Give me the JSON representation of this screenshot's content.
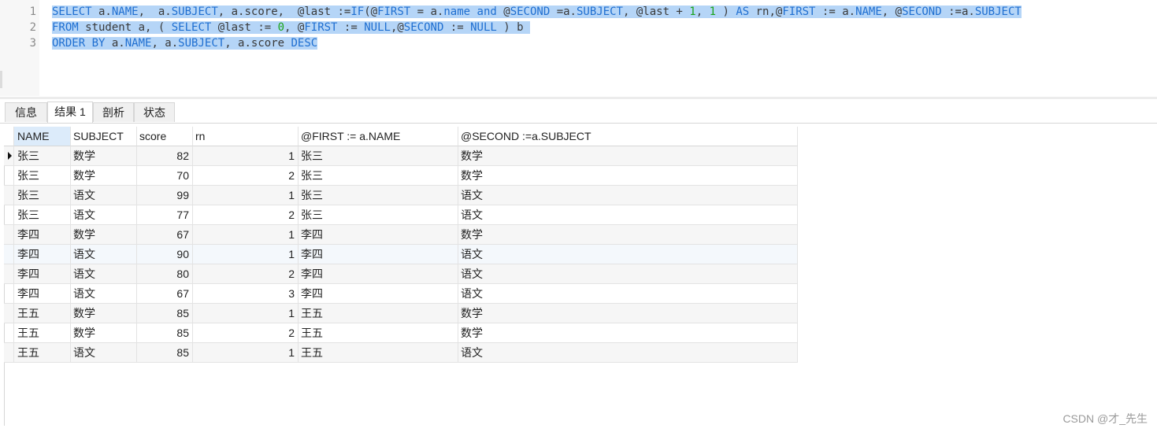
{
  "editor": {
    "line_numbers": [
      "1",
      "2",
      "3"
    ],
    "line1": [
      {
        "t": "SELECT",
        "k": "kw"
      },
      {
        "t": " a.",
        "k": ""
      },
      {
        "t": "NAME",
        "k": "kw"
      },
      {
        "t": ",  a.",
        "k": ""
      },
      {
        "t": "SUBJECT",
        "k": "kw"
      },
      {
        "t": ", a.score,  @last :=",
        "k": ""
      },
      {
        "t": "IF",
        "k": "kw"
      },
      {
        "t": "(@",
        "k": ""
      },
      {
        "t": "FIRST",
        "k": "kw"
      },
      {
        "t": " = a.",
        "k": ""
      },
      {
        "t": "name",
        "k": "kw"
      },
      {
        "t": " ",
        "k": ""
      },
      {
        "t": "and",
        "k": "kw"
      },
      {
        "t": " @",
        "k": ""
      },
      {
        "t": "SECOND",
        "k": "kw"
      },
      {
        "t": " =a.",
        "k": ""
      },
      {
        "t": "SUBJECT",
        "k": "kw"
      },
      {
        "t": ", @last + ",
        "k": ""
      },
      {
        "t": "1",
        "k": "num"
      },
      {
        "t": ", ",
        "k": ""
      },
      {
        "t": "1",
        "k": "num"
      },
      {
        "t": " ) ",
        "k": ""
      },
      {
        "t": "AS",
        "k": "kw"
      },
      {
        "t": " rn,@",
        "k": ""
      },
      {
        "t": "FIRST",
        "k": "kw"
      },
      {
        "t": " := a.",
        "k": ""
      },
      {
        "t": "NAME",
        "k": "kw"
      },
      {
        "t": ", @",
        "k": ""
      },
      {
        "t": "SECOND",
        "k": "kw"
      },
      {
        "t": " :=a.",
        "k": ""
      },
      {
        "t": "SUBJECT",
        "k": "kw"
      }
    ],
    "line2": [
      {
        "t": "FROM",
        "k": "kw"
      },
      {
        "t": " student a, ( ",
        "k": ""
      },
      {
        "t": "SELECT",
        "k": "kw"
      },
      {
        "t": " @last := ",
        "k": ""
      },
      {
        "t": "0",
        "k": "num"
      },
      {
        "t": ", @",
        "k": ""
      },
      {
        "t": "FIRST",
        "k": "kw"
      },
      {
        "t": " := ",
        "k": ""
      },
      {
        "t": "NULL",
        "k": "kw"
      },
      {
        "t": ",@",
        "k": ""
      },
      {
        "t": "SECOND",
        "k": "kw"
      },
      {
        "t": " := ",
        "k": ""
      },
      {
        "t": "NULL",
        "k": "kw"
      },
      {
        "t": " ) b ",
        "k": ""
      }
    ],
    "line3": [
      {
        "t": "ORDER BY",
        "k": "kw"
      },
      {
        "t": " a.",
        "k": ""
      },
      {
        "t": "NAME",
        "k": "kw"
      },
      {
        "t": ", a.",
        "k": ""
      },
      {
        "t": "SUBJECT",
        "k": "kw"
      },
      {
        "t": ", a.score ",
        "k": ""
      },
      {
        "t": "DESC",
        "k": "kw"
      }
    ]
  },
  "tabs": [
    {
      "label": "信息"
    },
    {
      "label": "结果 1"
    },
    {
      "label": "剖析"
    },
    {
      "label": "状态"
    }
  ],
  "grid": {
    "columns": [
      "NAME",
      "SUBJECT",
      "score",
      "rn",
      "@FIRST := a.NAME",
      "@SECOND :=a.SUBJECT"
    ],
    "rows": [
      [
        "张三",
        "数学",
        "82",
        "1",
        "张三",
        "数学"
      ],
      [
        "张三",
        "数学",
        "70",
        "2",
        "张三",
        "数学"
      ],
      [
        "张三",
        "语文",
        "99",
        "1",
        "张三",
        "语文"
      ],
      [
        "张三",
        "语文",
        "77",
        "2",
        "张三",
        "语文"
      ],
      [
        "李四",
        "数学",
        "67",
        "1",
        "李四",
        "数学"
      ],
      [
        "李四",
        "语文",
        "90",
        "1",
        "李四",
        "语文"
      ],
      [
        "李四",
        "语文",
        "80",
        "2",
        "李四",
        "语文"
      ],
      [
        "李四",
        "语文",
        "67",
        "3",
        "李四",
        "语文"
      ],
      [
        "王五",
        "数学",
        "85",
        "1",
        "王五",
        "数学"
      ],
      [
        "王五",
        "数学",
        "85",
        "2",
        "王五",
        "数学"
      ],
      [
        "王五",
        "语文",
        "85",
        "1",
        "王五",
        "语文"
      ]
    ]
  },
  "watermark": "CSDN @才_先生"
}
